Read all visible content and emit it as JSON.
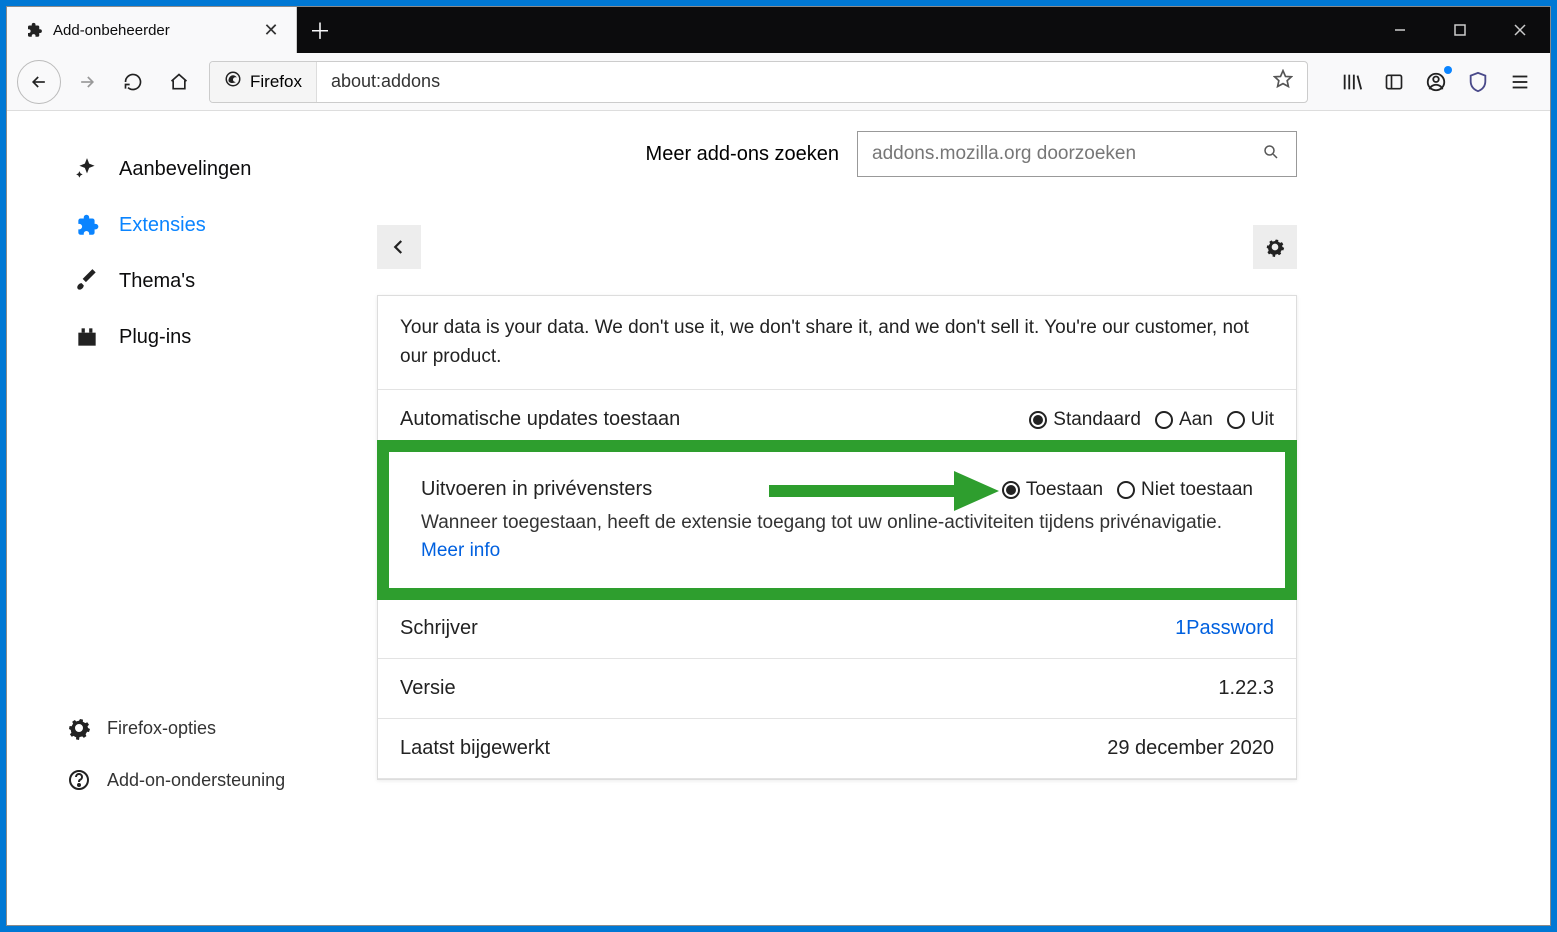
{
  "tab": {
    "title": "Add-onbeheerder"
  },
  "toolbar": {
    "identity": "Firefox",
    "url": "about:addons"
  },
  "search": {
    "label": "Meer add-ons zoeken",
    "placeholder": "addons.mozilla.org doorzoeken"
  },
  "sidebar": {
    "recommendations": "Aanbevelingen",
    "extensions": "Extensies",
    "themes": "Thema's",
    "plugins": "Plug-ins",
    "options": "Firefox-opties",
    "support": "Add-on-ondersteuning"
  },
  "detail": {
    "description": "Your data is your data. We don't use it, we don't share it, and we don't sell it. You're our customer, not our product.",
    "updates_label": "Automatische updates toestaan",
    "updates_options": {
      "default": "Standaard",
      "on": "Aan",
      "off": "Uit"
    },
    "private_title": "Uitvoeren in privévensters",
    "private_allow": "Toestaan",
    "private_deny": "Niet toestaan",
    "private_desc": "Wanneer toegestaan, heeft de extensie toegang tot uw online-activiteiten tijdens privénavigatie. ",
    "more_info": "Meer info",
    "author_label": "Schrijver",
    "author_value": "1Password",
    "version_label": "Versie",
    "version_value": "1.22.3",
    "updated_label": "Laatst bijgewerkt",
    "updated_value": "29 december 2020"
  }
}
